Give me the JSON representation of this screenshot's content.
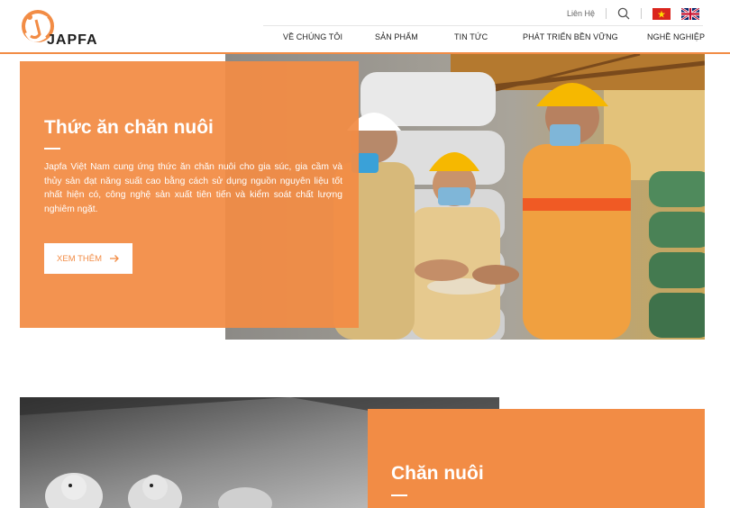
{
  "brand": {
    "name": "JAPFA",
    "accent": "#f28c45"
  },
  "utilities": {
    "contact_label": "Liên Hệ",
    "icons": [
      "search-icon",
      "flag-vietnam-icon",
      "flag-uk-icon"
    ]
  },
  "nav": {
    "items": [
      {
        "label": "VỀ CHÚNG TÔI"
      },
      {
        "label": "SẢN PHẨM"
      },
      {
        "label": "TIN TỨC"
      },
      {
        "label": "PHÁT TRIỂN BỀN VỮNG"
      },
      {
        "label": "NGHỀ NGHIỆP"
      }
    ]
  },
  "feature1": {
    "title": "Thức ăn chăn nuôi",
    "description": "Japfa Việt Nam cung ứng thức ăn chăn nuôi cho gia súc, gia cầm và thủy sản đạt năng suất cao bằng cách sử dụng nguồn nguyên liệu tốt nhất hiện có, công nghệ sản xuất tiên tiến và kiểm soát chất lượng nghiêm ngặt.",
    "button_label": "XEM THÊM"
  },
  "feature2": {
    "title": "Chăn nuôi"
  }
}
